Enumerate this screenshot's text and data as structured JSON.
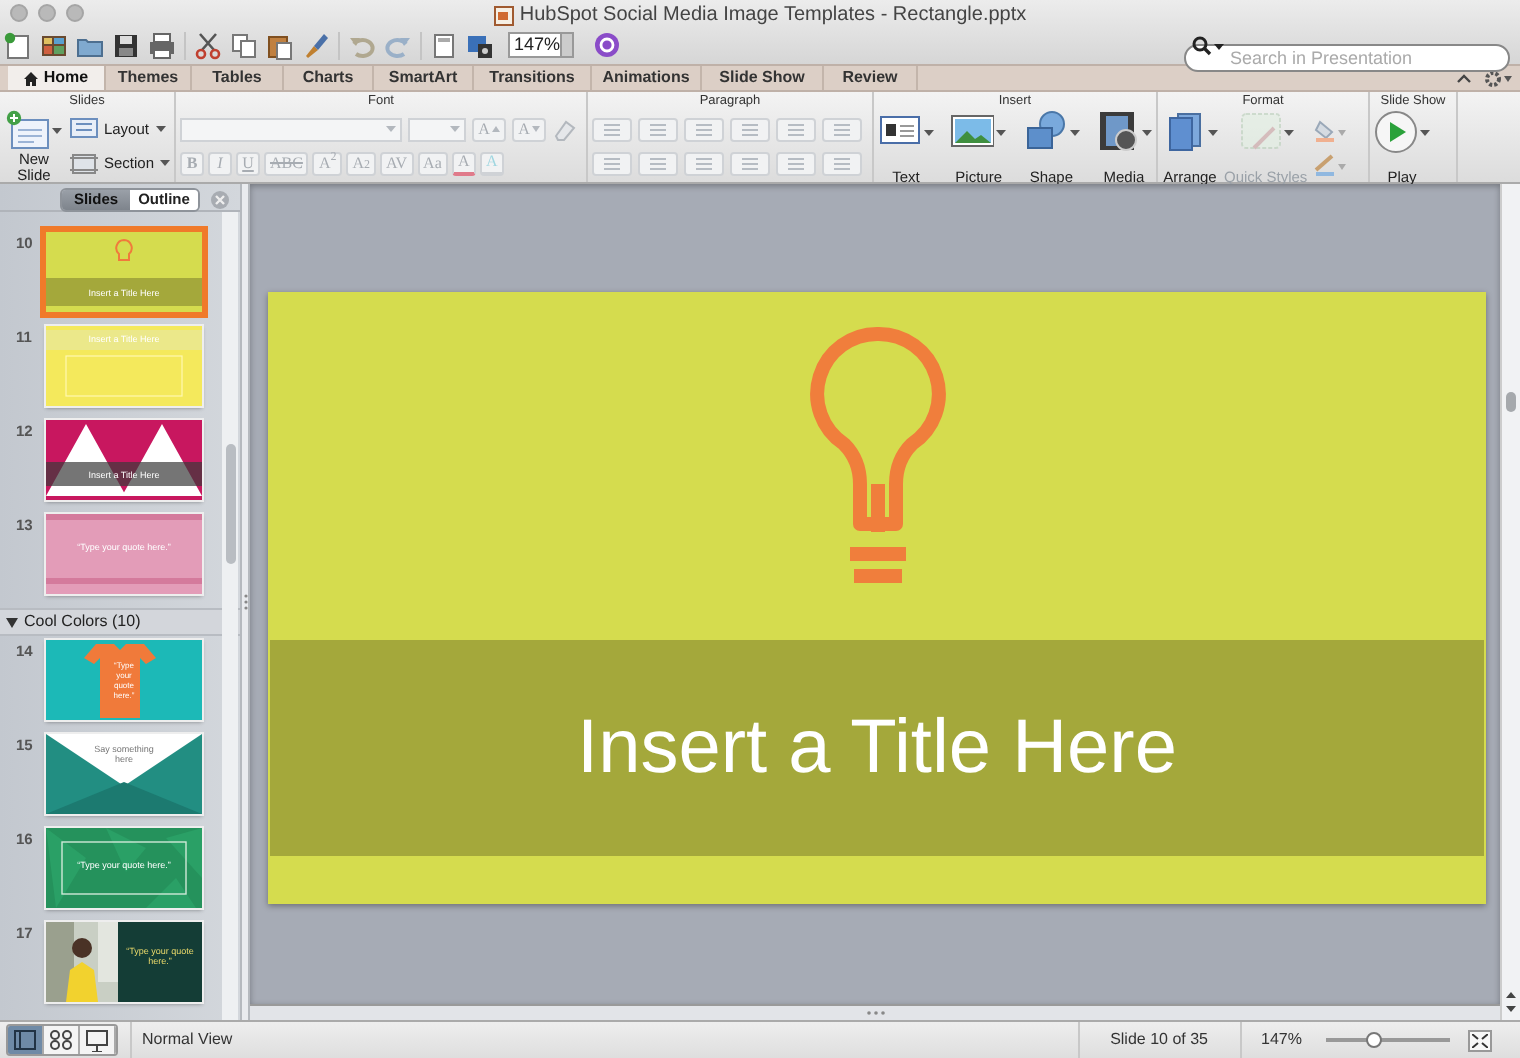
{
  "window": {
    "title": "HubSpot Social Media Image Templates - Rectangle.pptx"
  },
  "toolbar": {
    "zoom": "147%",
    "search": {
      "placeholder": "Search in Presentation"
    }
  },
  "tabs": [
    {
      "label": "Home",
      "selected": true
    },
    {
      "label": "Themes",
      "selected": false
    },
    {
      "label": "Tables",
      "selected": false
    },
    {
      "label": "Charts",
      "selected": false
    },
    {
      "label": "SmartArt",
      "selected": false
    },
    {
      "label": "Transitions",
      "selected": false
    },
    {
      "label": "Animations",
      "selected": false
    },
    {
      "label": "Slide Show",
      "selected": false
    },
    {
      "label": "Review",
      "selected": false
    }
  ],
  "ribbon": {
    "groups": [
      {
        "title": "Slides",
        "kind": "slides",
        "buttons": [
          {
            "label": "New Slide"
          },
          {
            "label": "Layout"
          },
          {
            "label": "Section"
          }
        ]
      },
      {
        "title": "Font",
        "kind": "font",
        "size_buttons": [
          "A",
          "A"
        ],
        "buttons": [
          "B",
          "I",
          "U",
          "ABC",
          "A$^{2}$",
          "A$_{2}$",
          "AV",
          "Aa",
          "A",
          "A"
        ]
      },
      {
        "title": "Paragraph",
        "kind": "paragraph"
      },
      {
        "title": "Insert",
        "kind": "insert",
        "buttons": [
          {
            "label": "Text",
            "kind": "text"
          },
          {
            "label": "Picture",
            "kind": "picture"
          },
          {
            "label": "Shape",
            "kind": "shape"
          },
          {
            "label": "Media",
            "kind": "media"
          }
        ]
      },
      {
        "title": "Format",
        "kind": "format",
        "buttons": [
          {
            "label": "Arrange",
            "kind": "arrange",
            "disabled": false
          },
          {
            "label": "Quick Styles",
            "kind": "styles",
            "disabled": true
          }
        ]
      },
      {
        "title": "Slide Show",
        "kind": "slideshow",
        "buttons": [
          {
            "label": "Play",
            "kind": "play"
          }
        ]
      }
    ]
  },
  "panel": {
    "tabs": [
      {
        "label": "Slides",
        "selected": true
      },
      {
        "label": "Outline",
        "selected": false
      }
    ],
    "items": [
      {
        "kind": "bulb",
        "number": "10",
        "selected": true,
        "text": "Insert a Title Here"
      },
      {
        "kind": "yellow",
        "number": "11",
        "selected": false,
        "text": "Insert a Title Here"
      },
      {
        "kind": "mountains",
        "number": "12",
        "selected": false,
        "text": "Insert a Title Here"
      },
      {
        "kind": "pink",
        "number": "13",
        "selected": false,
        "text": "“Type your quote here.”"
      },
      {
        "kind": "section",
        "label": "Cool Colors (10)",
        "expanded": true
      },
      {
        "kind": "shirt",
        "number": "14",
        "selected": false,
        "text": "“Type your quote here.”"
      },
      {
        "kind": "envelope",
        "number": "15",
        "selected": false,
        "text": "Say something here"
      },
      {
        "kind": "green",
        "number": "16",
        "selected": false,
        "text": "“Type your quote here.”"
      },
      {
        "number": "17",
        "selected": false,
        "text": "“Type your quote here.”"
      }
    ]
  },
  "slide": {
    "title": "Insert a Title Here"
  },
  "status_bar": {
    "views": [
      {
        "selected": true,
        "kind": "normal"
      },
      {
        "selected": false,
        "kind": "sorter"
      },
      {
        "selected": false,
        "kind": "show"
      }
    ],
    "view_name": "Normal View",
    "position": "Slide 10 of 35",
    "zoom": "147%",
    "zoom_slider": {
      "level": 0.38
    }
  }
}
